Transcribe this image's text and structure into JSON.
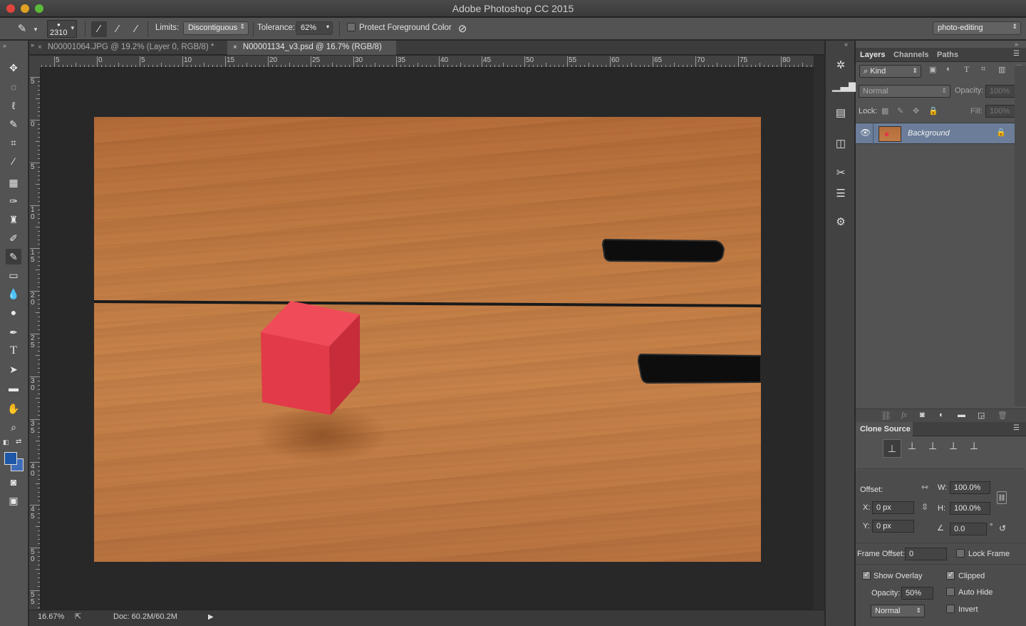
{
  "window": {
    "title": "Adobe Photoshop CC 2015"
  },
  "options_bar": {
    "brush_size": "2310",
    "limits_label": "Limits:",
    "limits_value": "Discontiguous",
    "tolerance_label": "Tolerance:",
    "tolerance_value": "62%",
    "protect_fg_label": "Protect Foreground Color",
    "workspace": "photo-editing"
  },
  "tabs": [
    {
      "label": "N00001064.JPG @ 19.2% (Layer 0, RGB/8) *",
      "active": false
    },
    {
      "label": "N00001134_v3.psd @ 16.7% (RGB/8)",
      "active": true
    }
  ],
  "ruler_top": [
    "5",
    "0",
    "5",
    "10",
    "15",
    "20",
    "25",
    "30",
    "35",
    "40",
    "45",
    "50",
    "55",
    "60",
    "65",
    "70",
    "75",
    "80"
  ],
  "ruler_left": [
    "5",
    "0",
    "5",
    "1 0",
    "1 5",
    "2 0",
    "2 5",
    "3 0",
    "3 5",
    "4 0",
    "4 5",
    "5 0",
    "5 5"
  ],
  "status": {
    "zoom": "16.67%",
    "doc": "Doc: 60.2M/60.2M"
  },
  "layers_panel": {
    "tabs": [
      "Layers",
      "Channels",
      "Paths"
    ],
    "filter_kind": "Kind",
    "blend_mode": "Normal",
    "opacity_label": "Opacity:",
    "opacity_value": "100%",
    "lock_label": "Lock:",
    "fill_label": "Fill:",
    "fill_value": "100%",
    "layers": [
      {
        "name": "Background",
        "visible": true,
        "locked": true
      }
    ]
  },
  "clone_source": {
    "title": "Clone Source",
    "offset_label": "Offset:",
    "w_label": "W:",
    "w_value": "100.0%",
    "h_label": "H:",
    "h_value": "100.0%",
    "x_label": "X:",
    "x_value": "0 px",
    "y_label": "Y:",
    "y_value": "0 px",
    "angle_value": "0.0",
    "angle_unit": "°",
    "frame_offset_label": "Frame Offset:",
    "frame_offset_value": "0",
    "lock_frame_label": "Lock Frame",
    "show_overlay_label": "Show Overlay",
    "clipped_label": "Clipped",
    "opacity_label": "Opacity:",
    "opacity_value": "50%",
    "auto_hide_label": "Auto Hide",
    "mode_value": "Normal",
    "invert_label": "Invert"
  },
  "colors": {
    "foreground": "#1f57a6",
    "background": "#3d6cb8",
    "cube": "#e23a48"
  }
}
